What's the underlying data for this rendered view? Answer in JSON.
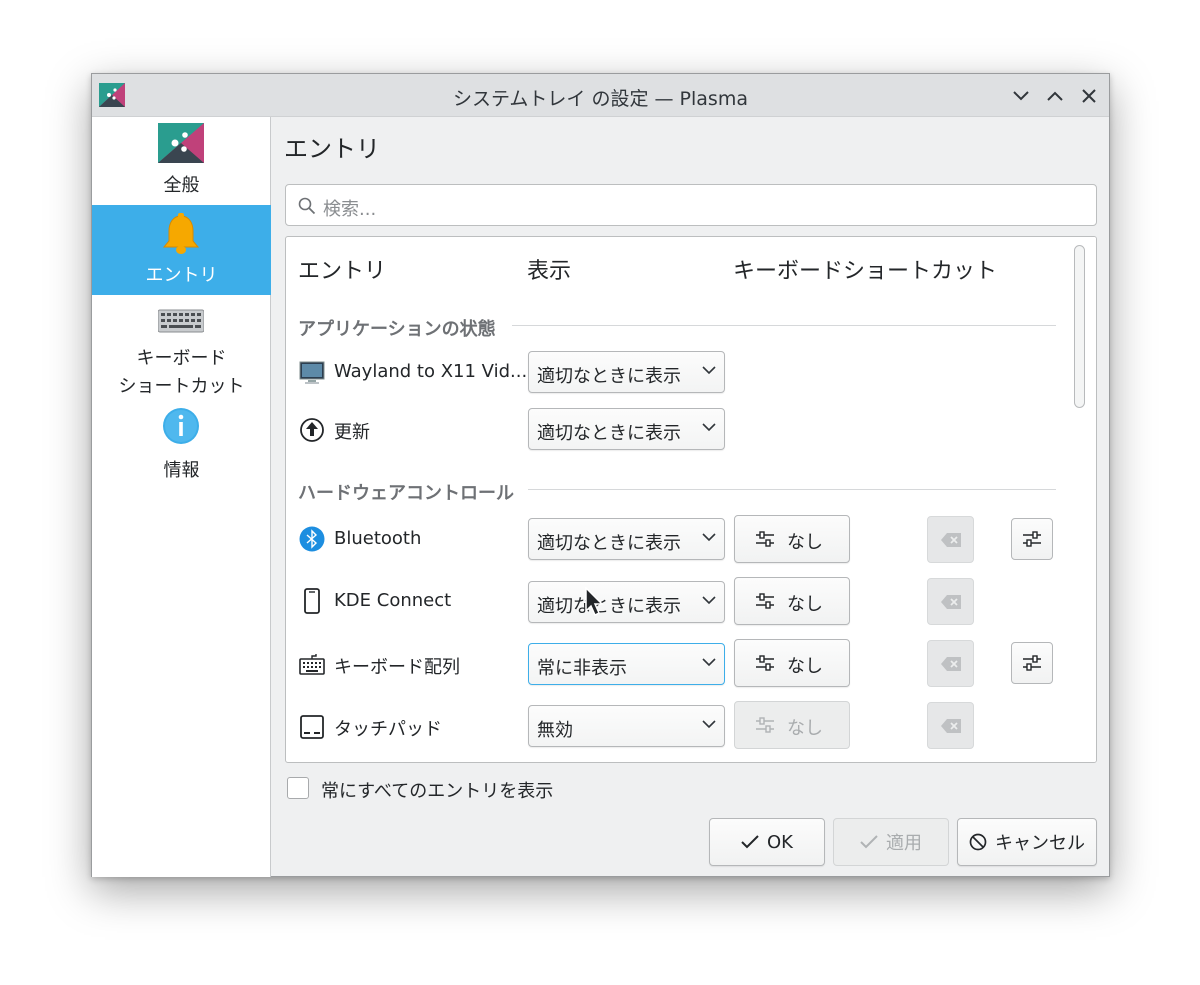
{
  "window": {
    "title": "システムトレイ の設定 — Plasma"
  },
  "sidebar": {
    "items": [
      {
        "label": "全般",
        "icon": "plasma-logo-icon",
        "active": false
      },
      {
        "label": "エントリ",
        "icon": "bell-icon",
        "active": true
      },
      {
        "label_line1": "キーボード",
        "label_line2": "ショートカット",
        "icon": "keyboard-icon",
        "active": false
      },
      {
        "label": "情報",
        "icon": "info-icon",
        "active": false
      }
    ]
  },
  "page": {
    "title": "エントリ",
    "search_placeholder": "検索..."
  },
  "table": {
    "headers": {
      "entry": "エントリ",
      "visibility": "表示",
      "shortcut": "キーボードショートカット"
    },
    "sections": [
      {
        "title": "アプリケーションの状態",
        "rows": [
          {
            "name": "Wayland to X11 Vid...",
            "icon": "monitor-icon",
            "visibility": "適切なときに表示"
          },
          {
            "name": "更新",
            "icon": "update-icon",
            "visibility": "適切なときに表示"
          }
        ]
      },
      {
        "title": "ハードウェアコントロール",
        "rows": [
          {
            "name": "Bluetooth",
            "icon": "bluetooth-icon",
            "visibility": "適切なときに表示",
            "shortcut": "なし"
          },
          {
            "name": "KDE Connect",
            "icon": "phone-icon",
            "visibility": "適切なときに表示",
            "shortcut": "なし"
          },
          {
            "name": "キーボード配列",
            "icon": "keyboard-layout-icon",
            "visibility": "常に非表示",
            "shortcut": "なし"
          },
          {
            "name": "タッチパッド",
            "icon": "touchpad-icon",
            "visibility": "無効",
            "shortcut": "なし"
          }
        ]
      }
    ]
  },
  "footer": {
    "show_all_label": "常にすべてのエントリを表示",
    "show_all_checked": false,
    "ok_label": "OK",
    "apply_label": "適用",
    "cancel_label": "キャンセル"
  },
  "colors": {
    "accent": "#3daee9",
    "window_bg": "#eff0f1",
    "titlebar_bg": "#dee0e2"
  }
}
